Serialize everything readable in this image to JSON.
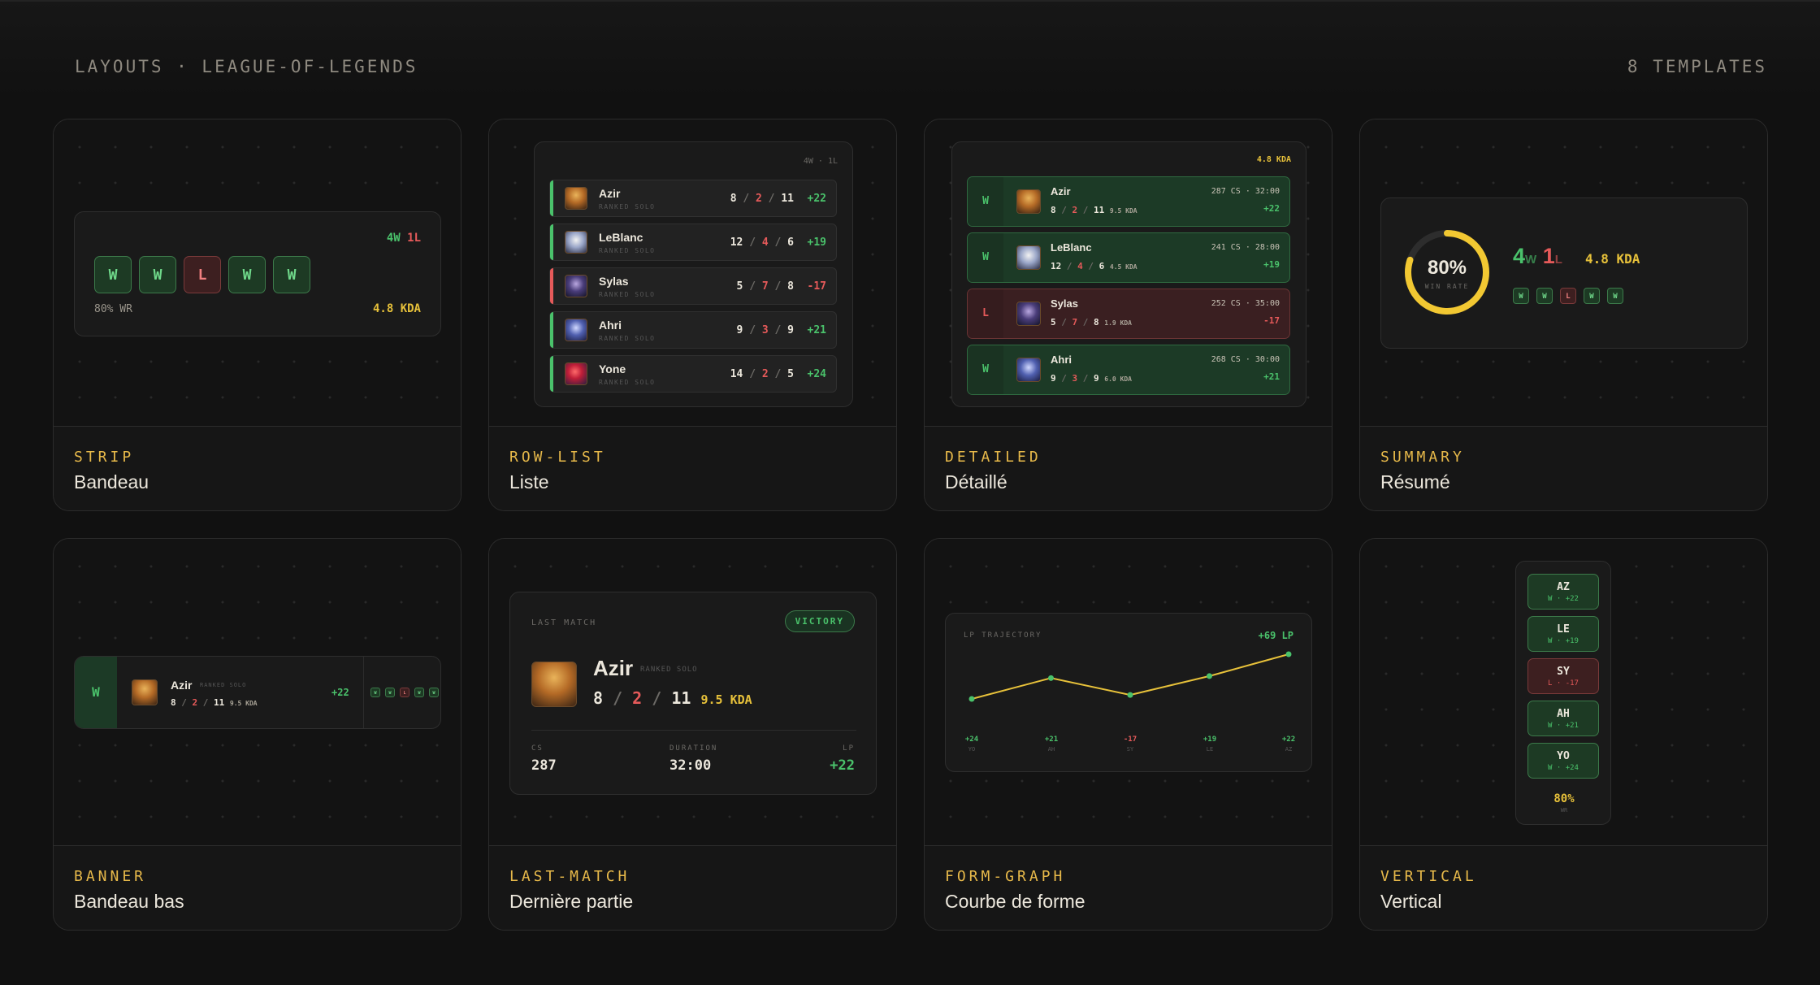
{
  "header": {
    "left": "LAYOUTS · LEAGUE-OF-LEGENDS",
    "right": "8 TEMPLATES"
  },
  "colors": {
    "win": "#4ac26b",
    "loss": "#e65a5a",
    "gold": "#e7c13a",
    "accent": "#e7b94a",
    "bg": "#111111"
  },
  "strip": {
    "tag": "STRIP",
    "title": "Bandeau",
    "record_w": "4W",
    "record_l": "1L",
    "results": [
      "W",
      "W",
      "L",
      "W",
      "W"
    ],
    "wr": "80% WR",
    "kda": "4.8 KDA"
  },
  "rowlist": {
    "tag": "ROW-LIST",
    "title": "Liste",
    "record": "4W · 1L",
    "queue": "RANKED SOLO",
    "rows": [
      {
        "champ": "Azir",
        "k": "8",
        "d": "2",
        "a": "11",
        "lp": "+22",
        "result": "W"
      },
      {
        "champ": "LeBlanc",
        "k": "12",
        "d": "4",
        "a": "6",
        "lp": "+19",
        "result": "W"
      },
      {
        "champ": "Sylas",
        "k": "5",
        "d": "7",
        "a": "8",
        "lp": "-17",
        "result": "L"
      },
      {
        "champ": "Ahri",
        "k": "9",
        "d": "3",
        "a": "9",
        "lp": "+21",
        "result": "W"
      },
      {
        "champ": "Yone",
        "k": "14",
        "d": "2",
        "a": "5",
        "lp": "+24",
        "result": "W"
      }
    ]
  },
  "detailed": {
    "tag": "DETAILED",
    "title": "Détaillé",
    "kda": "4.8 KDA",
    "rows": [
      {
        "result": "W",
        "champ": "Azir",
        "k": "8",
        "d": "2",
        "a": "11",
        "kda": "9.5 KDA",
        "meta": "287 CS · 32:00",
        "lp": "+22"
      },
      {
        "result": "W",
        "champ": "LeBlanc",
        "k": "12",
        "d": "4",
        "a": "6",
        "kda": "4.5 KDA",
        "meta": "241 CS · 28:00",
        "lp": "+19"
      },
      {
        "result": "L",
        "champ": "Sylas",
        "k": "5",
        "d": "7",
        "a": "8",
        "kda": "1.9 KDA",
        "meta": "252 CS · 35:00",
        "lp": "-17"
      },
      {
        "result": "W",
        "champ": "Ahri",
        "k": "9",
        "d": "3",
        "a": "9",
        "kda": "6.0 KDA",
        "meta": "268 CS · 30:00",
        "lp": "+21"
      }
    ]
  },
  "summary": {
    "tag": "SUMMARY",
    "title": "Résumé",
    "pct": "80%",
    "pct_value": 0.8,
    "sub": "WIN RATE",
    "wins": "4",
    "wins_suffix": "W",
    "losses": "1",
    "losses_suffix": "L",
    "kda": "4.8 KDA",
    "results": [
      "W",
      "W",
      "L",
      "W",
      "W"
    ]
  },
  "banner": {
    "tag": "BANNER",
    "title": "Bandeau bas",
    "result": "W",
    "champ": "Azir",
    "queue": "RANKED SOLO",
    "k": "8",
    "d": "2",
    "a": "11",
    "kda": "9.5 KDA",
    "lp": "+22",
    "results": [
      "W",
      "W",
      "L",
      "W",
      "W"
    ]
  },
  "lastmatch": {
    "tag": "LAST-MATCH",
    "title": "Dernière partie",
    "label": "LAST MATCH",
    "badge": "VICTORY",
    "champ": "Azir",
    "queue": "RANKED SOLO",
    "k": "8",
    "d": "2",
    "a": "11",
    "kda": "9.5 KDA",
    "stats": [
      {
        "label": "CS",
        "value": "287"
      },
      {
        "label": "DURATION",
        "value": "32:00"
      },
      {
        "label": "LP",
        "value": "+22"
      }
    ]
  },
  "formgraph": {
    "tag": "FORM-GRAPH",
    "title": "Courbe de forme",
    "label": "LP TRAJECTORY",
    "total": "+69 LP",
    "points": [
      {
        "lp": "+24",
        "abbr": "YO"
      },
      {
        "lp": "+21",
        "abbr": "AH"
      },
      {
        "lp": "-17",
        "abbr": "SY"
      },
      {
        "lp": "+19",
        "abbr": "LE"
      },
      {
        "lp": "+22",
        "abbr": "AZ"
      }
    ]
  },
  "vertical": {
    "tag": "VERTICAL",
    "title": "Vertical",
    "wr": "80%",
    "wr_label": "WR",
    "rows": [
      {
        "abbr": "AZ",
        "line": "W · +22",
        "result": "W"
      },
      {
        "abbr": "LE",
        "line": "W · +19",
        "result": "W"
      },
      {
        "abbr": "SY",
        "line": "L · -17",
        "result": "L"
      },
      {
        "abbr": "AH",
        "line": "W · +21",
        "result": "W"
      },
      {
        "abbr": "YO",
        "line": "W · +24",
        "result": "W"
      }
    ]
  }
}
